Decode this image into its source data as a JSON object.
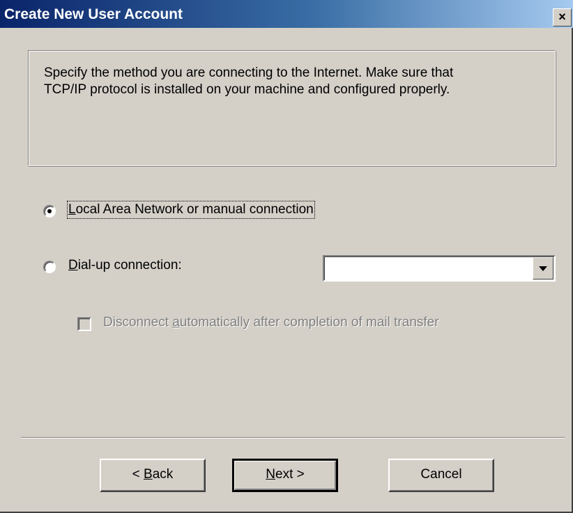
{
  "window": {
    "title": "Create New User Account",
    "close_glyph": "×"
  },
  "info": {
    "line1": "Specify the method you are connecting to the Internet. Make sure that",
    "line2": "TCP/IP protocol is installed on your machine and configured properly."
  },
  "options": {
    "lan": {
      "label": "Local Area Network or manual connection",
      "selected": true
    },
    "dialup": {
      "label": "Dial-up connection:",
      "selected": false
    },
    "dialup_select_value": "",
    "disconnect": {
      "label": "Disconnect automatically after completion of mail transfer",
      "checked": false,
      "disabled": true
    }
  },
  "buttons": {
    "back": "< Back",
    "next": "Next >",
    "cancel": "Cancel"
  },
  "colors": {
    "title_gradient_start": "#0a246a",
    "title_gradient_end": "#a6caf0",
    "face": "#d4d0c8"
  }
}
